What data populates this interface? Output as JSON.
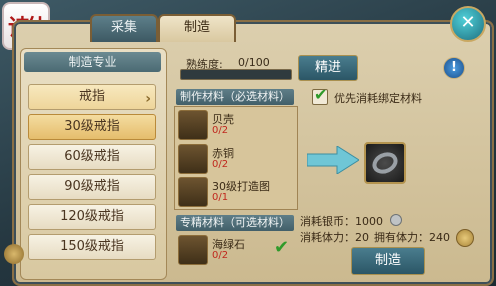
{
  "tabs": {
    "collect": "采集",
    "craft": "制造"
  },
  "logo_text": "诗仙",
  "left_panel": {
    "header": "制造专业",
    "items": [
      "戒指",
      "30级戒指",
      "60级戒指",
      "90级戒指",
      "120级戒指",
      "150级戒指"
    ]
  },
  "proficiency": {
    "label": "熟练度:",
    "value": "0/100",
    "progress": 0
  },
  "advance_button": "精进",
  "required_section": "制作材料（必选材料）",
  "materials": [
    {
      "name": "贝壳",
      "count": "0/2"
    },
    {
      "name": "赤铜",
      "count": "0/2"
    },
    {
      "name": "30级打造图",
      "count": "0/1"
    }
  ],
  "optional_section": "专精材料（可选材料）",
  "optional_materials": [
    {
      "name": "海绿石",
      "count": "0/2"
    }
  ],
  "bind_option": "优先消耗绑定材料",
  "stats": {
    "silver": "消耗银币：1000",
    "stamina_cost": "消耗体力：20",
    "stamina_have": "拥有体力：240"
  },
  "craft_button": "制造",
  "colors": {
    "accent": "#4a7d8e",
    "warning": "#c0281e",
    "frame": "#cbb98f"
  }
}
